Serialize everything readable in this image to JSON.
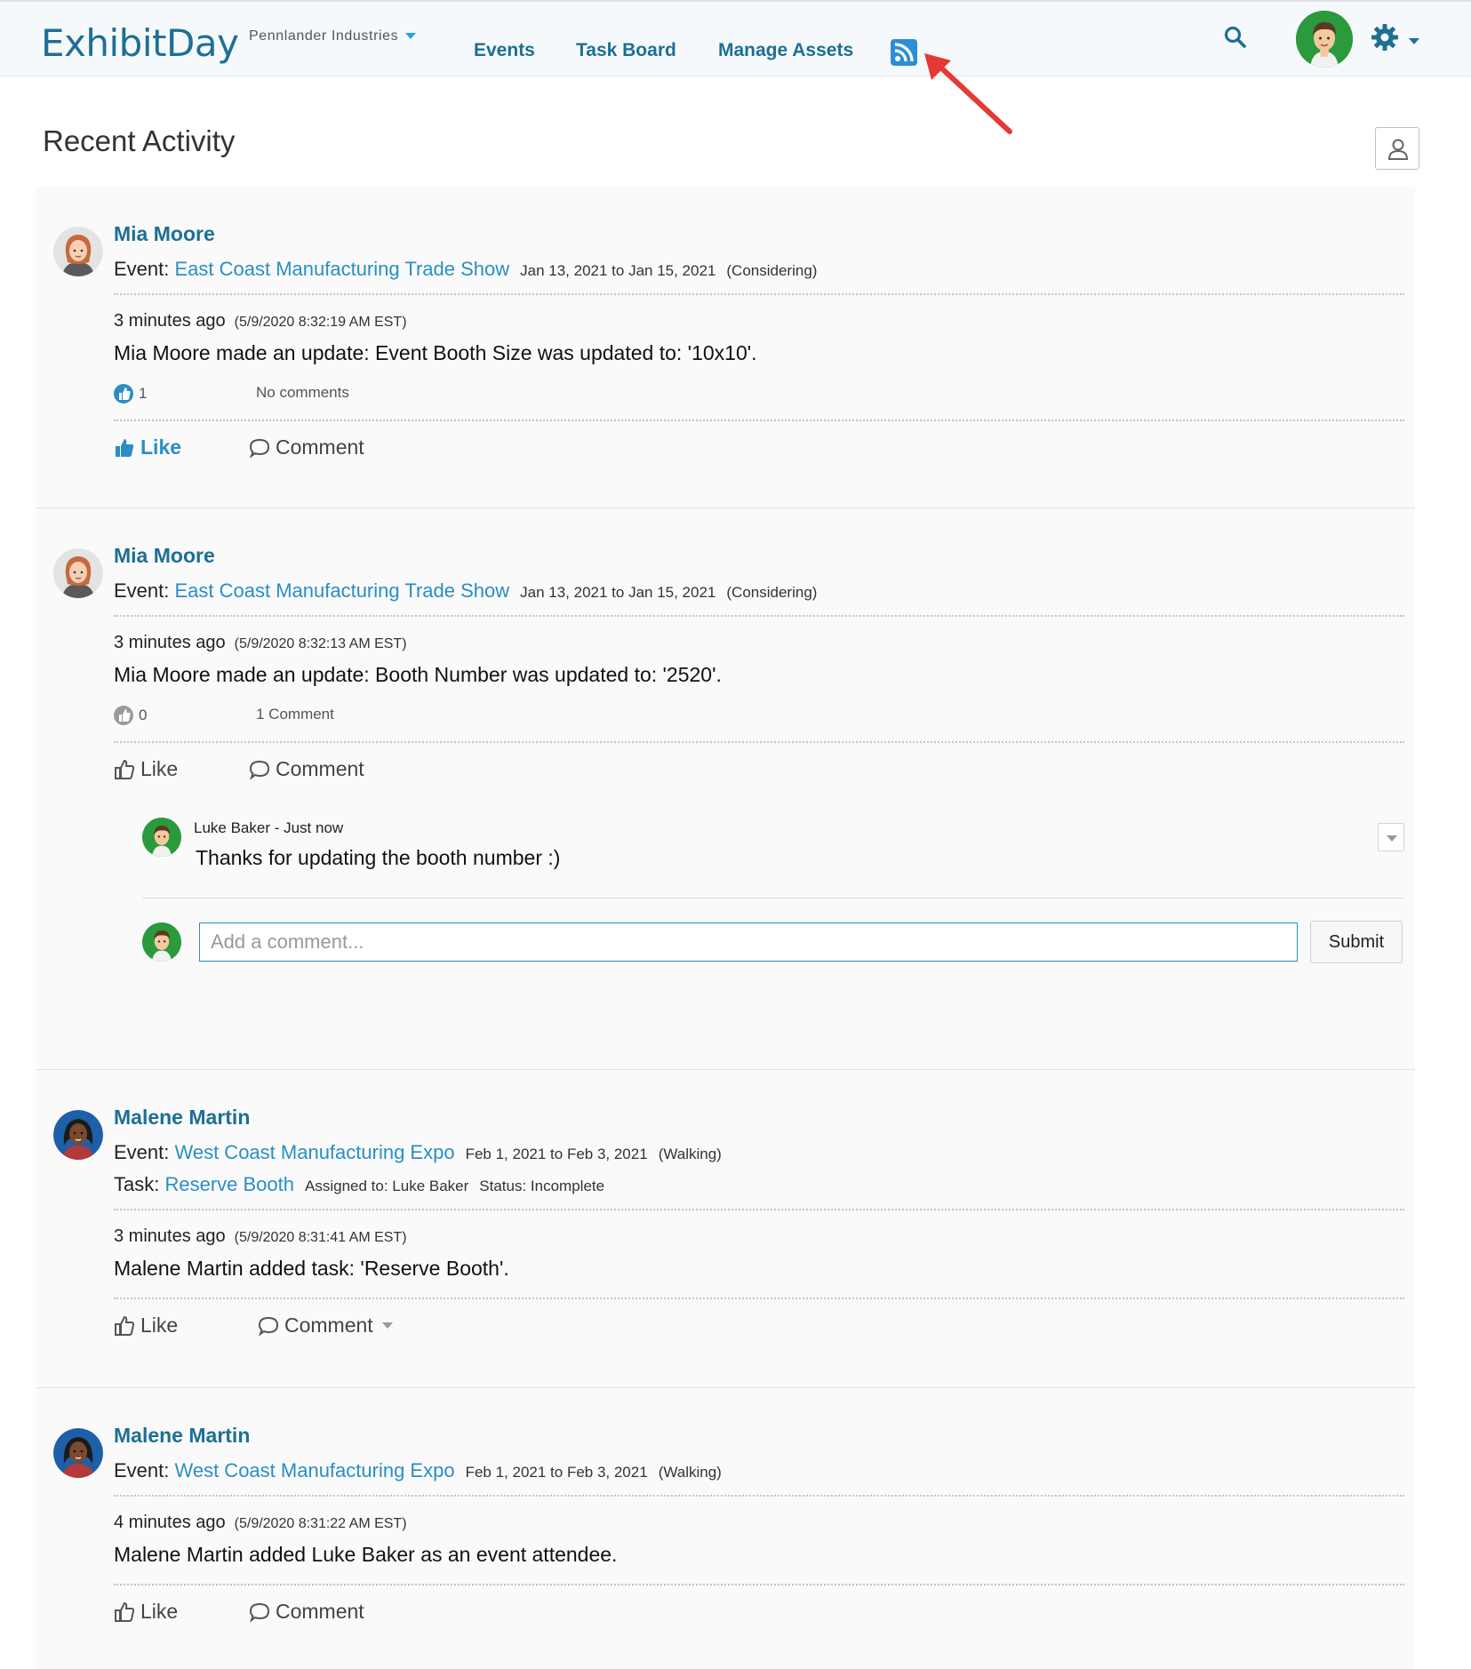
{
  "header": {
    "logo_exhibit": "Exhibit",
    "logo_day": "Day",
    "company": "Pennlander Industries",
    "nav": {
      "events": "Events",
      "task_board": "Task Board",
      "manage_assets": "Manage Assets"
    },
    "rss_icon": "rss-feed-icon",
    "search_icon": "search-icon",
    "gear_icon": "gear-icon"
  },
  "page": {
    "title": "Recent Activity"
  },
  "colors": {
    "brand": "#1d6f94",
    "link": "#2a8ec4",
    "rss": "#2b8fd6",
    "arrow": "#e53935"
  },
  "posts": [
    {
      "name": "Mia Moore",
      "event_prefix": "Event: ",
      "event": "East Coast Manufacturing Trade Show",
      "dates": "Jan 13, 2021 to Jan 15, 2021",
      "status": "(Considering)",
      "when": "3 minutes ago",
      "timestamp": "(5/9/2020 8:32:19 AM EST)",
      "message": "Mia Moore made an update: Event Booth Size was updated to: '10x10'.",
      "like_count": "1",
      "comment_count": "No comments",
      "like_label": "Like",
      "comment_label": "Comment"
    },
    {
      "name": "Mia Moore",
      "event_prefix": "Event: ",
      "event": "East Coast Manufacturing Trade Show",
      "dates": "Jan 13, 2021 to Jan 15, 2021",
      "status": "(Considering)",
      "when": "3 minutes ago",
      "timestamp": "(5/9/2020 8:32:13 AM EST)",
      "message": "Mia Moore made an update: Booth Number was updated to: '2520'.",
      "like_count": "0",
      "comment_count": "1 Comment",
      "like_label": "Like",
      "comment_label": "Comment",
      "comments": [
        {
          "author": "Luke Baker",
          "time": " - Just now",
          "text": "Thanks for updating the booth number :)"
        }
      ],
      "comment_placeholder": "Add a comment...",
      "submit_label": "Submit"
    },
    {
      "name": "Malene Martin",
      "event_prefix": "Event: ",
      "event": "West Coast Manufacturing Expo",
      "dates": "Feb 1, 2021 to Feb 3, 2021",
      "status": "(Walking)",
      "task_prefix": "Task: ",
      "task": "Reserve Booth",
      "assigned": "Assigned to: Luke Baker",
      "task_status": "Status: Incomplete",
      "when": "3 minutes ago",
      "timestamp": "(5/9/2020 8:31:41 AM EST)",
      "message": "Malene Martin added task: 'Reserve Booth'.",
      "like_label": "Like",
      "comment_label": "Comment"
    },
    {
      "name": "Malene Martin",
      "event_prefix": "Event: ",
      "event": "West Coast Manufacturing Expo",
      "dates": "Feb 1, 2021 to Feb 3, 2021",
      "status": "(Walking)",
      "when": "4 minutes ago",
      "timestamp": "(5/9/2020 8:31:22 AM EST)",
      "message": "Malene Martin added Luke Baker as an event attendee.",
      "like_label": "Like",
      "comment_label": "Comment"
    }
  ]
}
